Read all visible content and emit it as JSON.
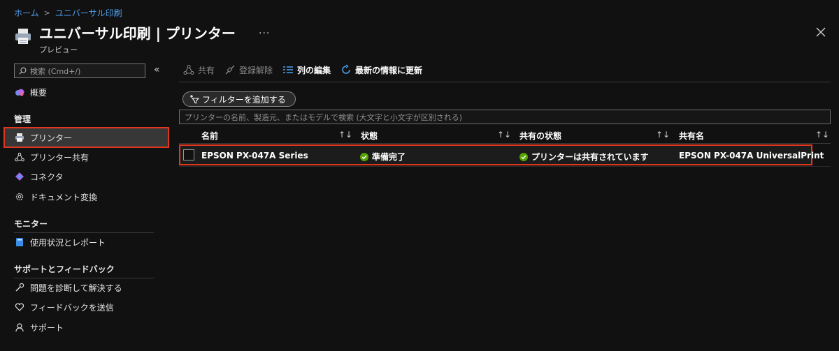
{
  "breadcrumb": {
    "home": "ホーム",
    "current": "ユニバーサル印刷"
  },
  "header": {
    "title": "ユニバーサル印刷 | プリンター",
    "subtitle": "プレビュー",
    "more": "···"
  },
  "sidebar": {
    "search_placeholder": "検索 (Cmd+/)",
    "collapse": "«",
    "overview": "概要",
    "sections": {
      "manage": "管理",
      "monitor": "モニター",
      "support": "サポートとフィードバック"
    },
    "items": {
      "printers": "プリンター",
      "printer_share": "プリンター共有",
      "connector": "コネクタ",
      "doc_convert": "ドキュメント変換",
      "usage": "使用状況とレポート",
      "diagnose": "問題を診断して解決する",
      "feedback": "フィードバックを送信",
      "support": "サポート"
    }
  },
  "toolbar": {
    "share": "共有",
    "unregister": "登録解除",
    "edit_columns": "列の編集",
    "refresh": "最新の情報に更新"
  },
  "filter": {
    "add_filter": "フィルターを追加する"
  },
  "table": {
    "search_placeholder": "プリンターの名前、製造元、またはモデルで検索 (大文字と小文字が区別される)",
    "columns": [
      "名前",
      "状態",
      "共有の状態",
      "共有名"
    ],
    "sort_glyph": "↑↓",
    "rows": [
      {
        "name": "EPSON PX-047A Series",
        "status": "準備完了",
        "share_status": "プリンターは共有されています",
        "share_name": "EPSON PX-047A UniversalPrint"
      }
    ]
  },
  "colors": {
    "accent": "#4ea0f0",
    "highlight": "#e0381f",
    "success": "#57a300"
  }
}
